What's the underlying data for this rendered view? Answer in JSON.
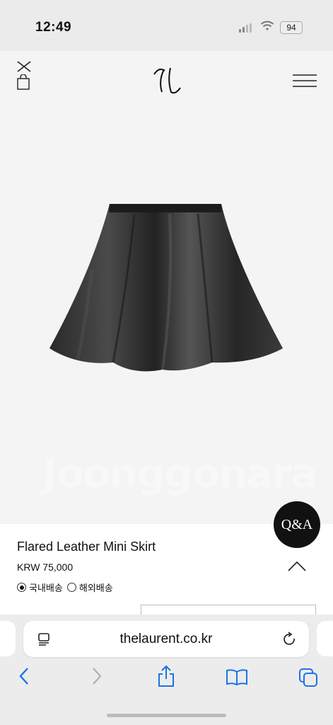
{
  "status_bar": {
    "time": "12:49",
    "battery": "94"
  },
  "header": {
    "logo_text": "TL"
  },
  "product": {
    "name": "Flared Leather Mini Skirt",
    "price": "KRW 75,000",
    "watermark": "Joonggonara",
    "shipping_options": [
      {
        "label": "국내배송",
        "selected": true
      },
      {
        "label": "해외배송",
        "selected": false
      }
    ]
  },
  "qa_button": {
    "label": "Q&A"
  },
  "browser": {
    "url": "thelaurent.co.kr"
  },
  "colors": {
    "accent": "#111111",
    "link_blue": "#1a73e8"
  }
}
